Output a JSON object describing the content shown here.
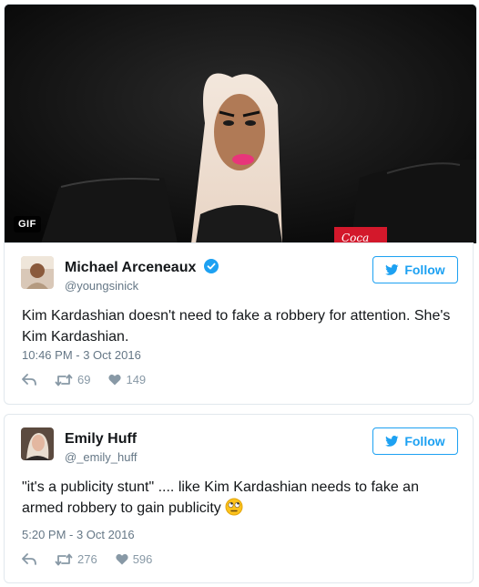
{
  "gif": {
    "badge": "GIF"
  },
  "tweets": [
    {
      "name": "Michael Arceneaux",
      "handle": "@youngsinick",
      "verified": true,
      "follow_label": "Follow",
      "text": "Kim Kardashian doesn't need to fake a robbery for attention. She's Kim Kardashian.",
      "timestamp": "10:46 PM - 3 Oct 2016",
      "retweets": "69",
      "likes": "149"
    },
    {
      "name": "Emily Huff",
      "handle": "@_emily_huff",
      "verified": false,
      "follow_label": "Follow",
      "text": "\"it's a publicity stunt\" .... like Kim Kardashian needs to fake an armed robbery to gain publicity",
      "emoji": "eye-roll-emoji",
      "timestamp": "5:20 PM - 3 Oct 2016",
      "retweets": "276",
      "likes": "596"
    }
  ],
  "colors": {
    "twitter_blue": "#1da1f2",
    "meta_gray": "#657786",
    "action_gray": "#8899a6"
  }
}
